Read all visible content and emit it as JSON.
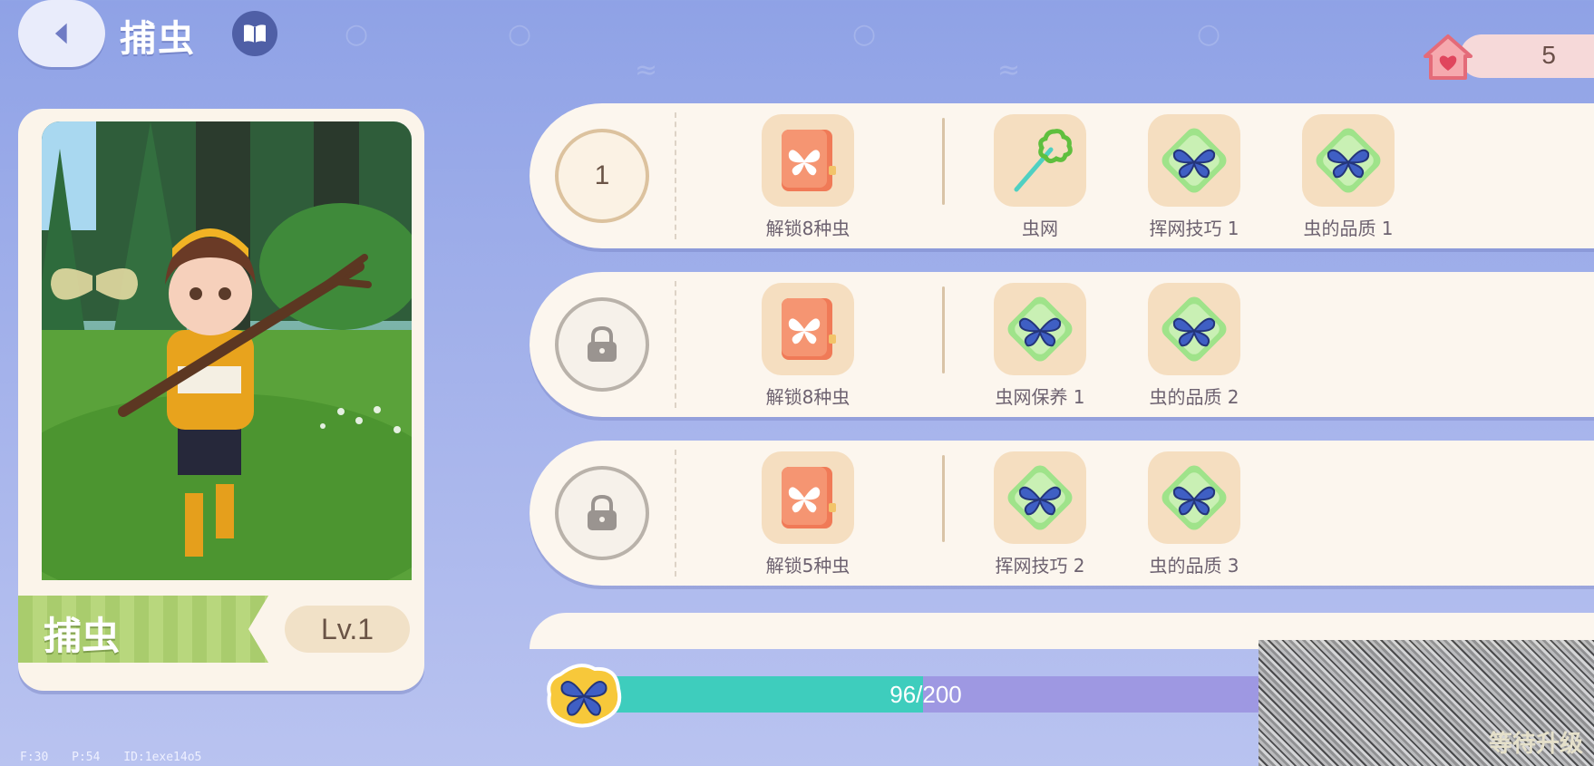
{
  "header": {
    "title": "捕虫",
    "home_count": "5"
  },
  "character_card": {
    "skill_name": "捕虫",
    "level": "Lv.1"
  },
  "tiers": [
    {
      "tier_label": "1",
      "locked": false,
      "requirement": {
        "icon": "butterfly-book-icon",
        "label": "解锁8种虫"
      },
      "rewards": [
        {
          "icon": "bug-net-icon",
          "label": "虫网"
        },
        {
          "icon": "butterfly-gem-icon",
          "label": "挥网技巧 1"
        },
        {
          "icon": "butterfly-gem-icon",
          "label": "虫的品质 1"
        }
      ]
    },
    {
      "tier_label": "",
      "locked": true,
      "requirement": {
        "icon": "butterfly-book-icon",
        "label": "解锁8种虫"
      },
      "rewards": [
        {
          "icon": "butterfly-gem-icon",
          "label": "虫网保养 1"
        },
        {
          "icon": "butterfly-gem-icon",
          "label": "虫的品质 2"
        }
      ]
    },
    {
      "tier_label": "",
      "locked": true,
      "requirement": {
        "icon": "butterfly-book-icon",
        "label": "解锁5种虫"
      },
      "rewards": [
        {
          "icon": "butterfly-gem-icon",
          "label": "挥网技巧 2"
        },
        {
          "icon": "butterfly-gem-icon",
          "label": "虫的品质 3"
        }
      ]
    }
  ],
  "progress": {
    "text": "96/200",
    "fraction": 0.48
  },
  "upgrade_button_label": "等待升级",
  "debug_text": "F:30 P:54 ID:1exe14o5",
  "colors": {
    "progress_fill": "#3ecdbd",
    "progress_track": "#9e98e2",
    "card_bg": "#fcf6ee",
    "tile_bg": "#f5dec0"
  }
}
